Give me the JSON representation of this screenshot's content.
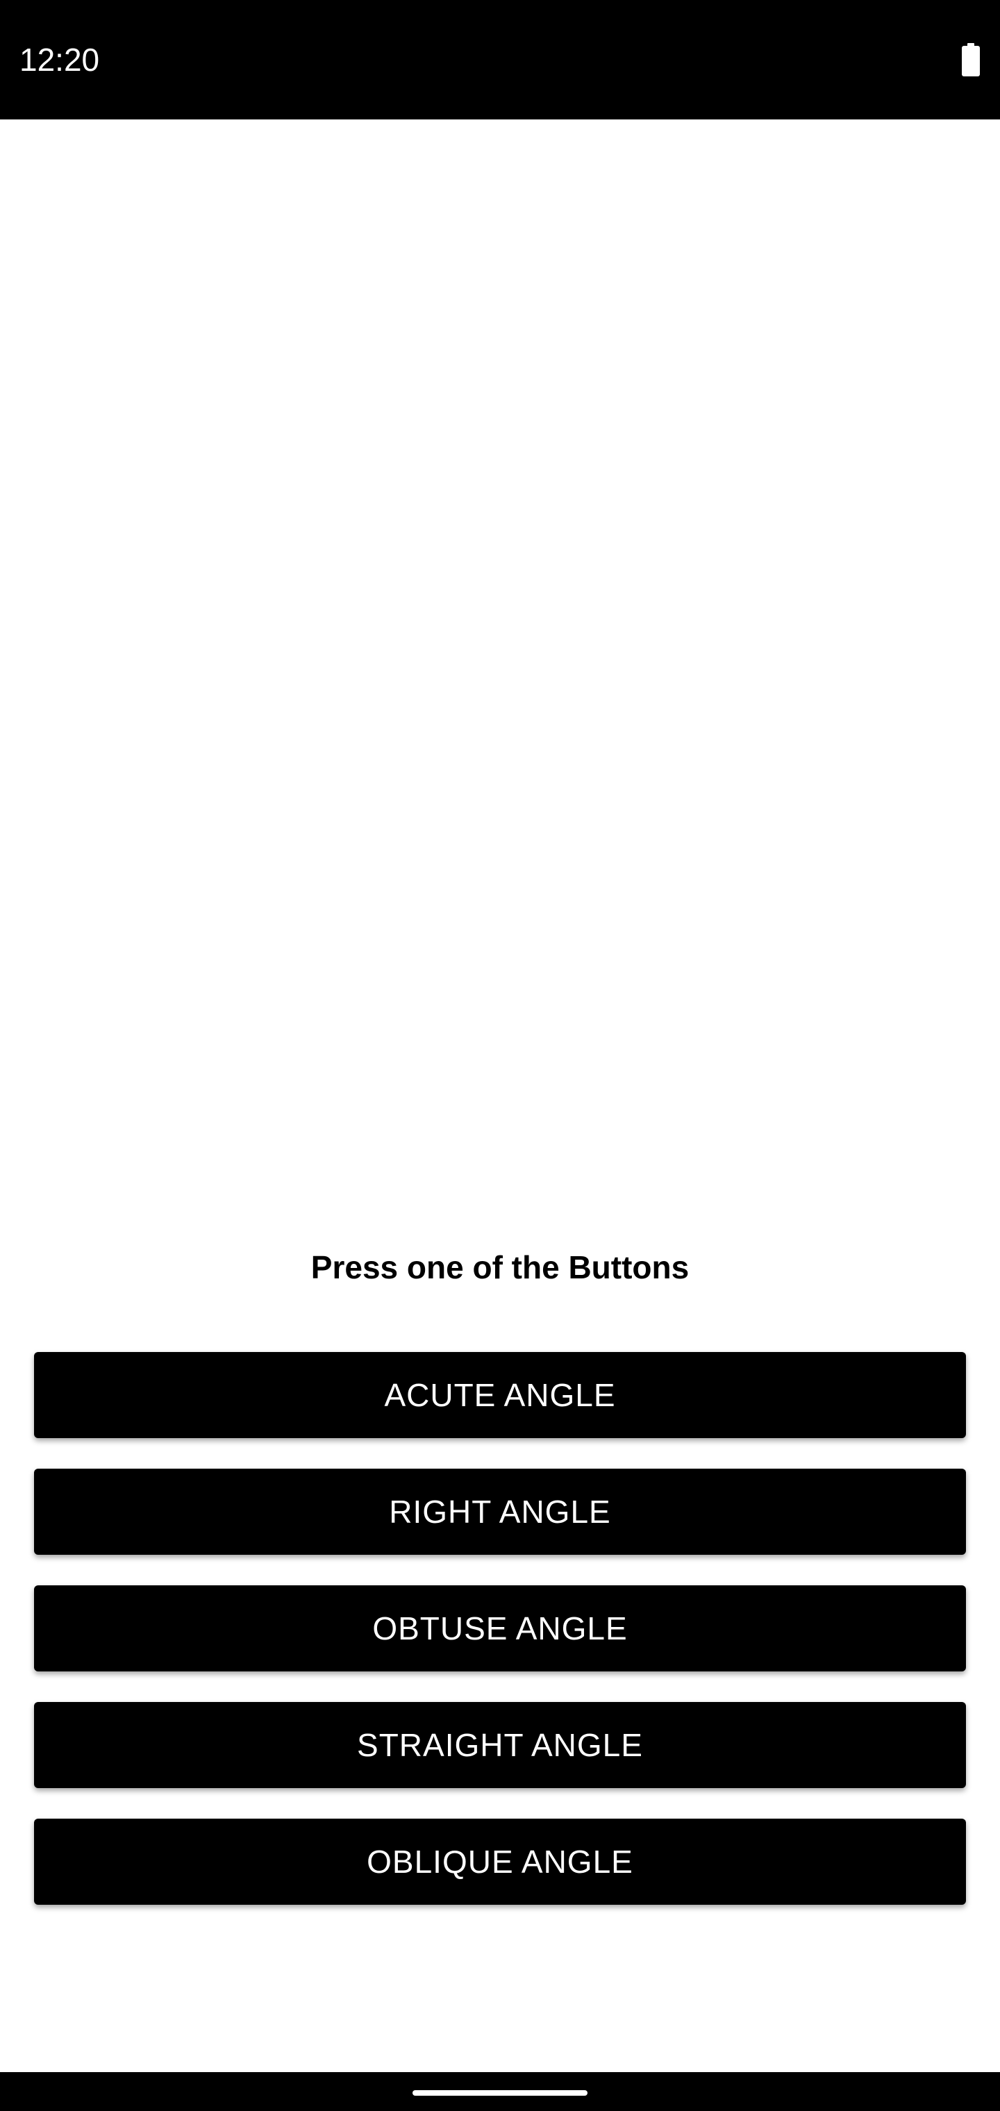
{
  "status_bar": {
    "time": "12:20",
    "battery_icon": "battery-full-icon"
  },
  "main": {
    "prompt": "Press one of the Buttons",
    "buttons": [
      {
        "label": "ACUTE ANGLE"
      },
      {
        "label": "RIGHT ANGLE"
      },
      {
        "label": "OBTUSE ANGLE"
      },
      {
        "label": "STRAIGHT ANGLE"
      },
      {
        "label": "OBLIQUE ANGLE"
      }
    ]
  },
  "nav_bar": {
    "home_indicator": "home-indicator"
  },
  "colors": {
    "background": "#ffffff",
    "button_background": "#000000",
    "button_text": "#ffffff",
    "status_bar": "#000000"
  }
}
